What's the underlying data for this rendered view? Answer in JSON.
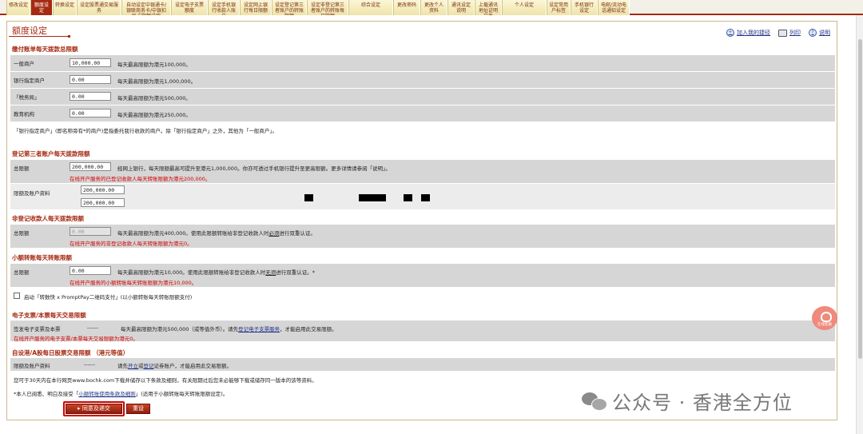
{
  "tabs": [
    {
      "label": "修改设定",
      "active": false
    },
    {
      "label": "额度设定",
      "active": true
    },
    {
      "label": "转换设定",
      "active": false
    },
    {
      "label": "设定股票通交易服务",
      "active": false
    },
    {
      "label": "自动设定中银通卡/银联商务卡/中银扣账卡限额设定",
      "active": false
    },
    {
      "label": "设定电子支票额度",
      "active": false
    },
    {
      "label": "设定手机银行收款人账户",
      "active": false
    },
    {
      "label": "设定网上银行每日限额",
      "active": false
    },
    {
      "label": "设定登记第三者账户的转账限额",
      "active": false
    },
    {
      "label": "设定非登记第三者账户的转账每日限额",
      "active": false
    },
    {
      "label": "综合设定",
      "active": false
    },
    {
      "label": "更改密码",
      "active": false
    },
    {
      "label": "更改个人资料",
      "active": false
    },
    {
      "label": "通讯设定说明",
      "active": false
    },
    {
      "label": "上载通讯地址证明文件",
      "active": false
    },
    {
      "label": "个人设定",
      "active": false
    },
    {
      "label": "设定常用户标签",
      "active": false
    },
    {
      "label": "手机银行设定",
      "active": false
    },
    {
      "label": "电邮/流动电话通知设定",
      "active": false
    }
  ],
  "page_title": "额度设定",
  "toplinks": {
    "bookmark": "加入我的捷径",
    "print": "列印",
    "help": "说明"
  },
  "s1": {
    "title": "缴付账单每天拨款总限额",
    "rows": [
      {
        "label": "一般商户",
        "value": "10,000.00",
        "desc": "每天最高限额为港元100,000。"
      },
      {
        "label": "银行指定商户",
        "value": "0.00",
        "desc": "每天最高限额为港元1,000,000。"
      },
      {
        "label": "「税务局」",
        "value": "0.00",
        "desc": "每天最高限额为港元500,000。"
      },
      {
        "label": "教育机构",
        "value": "0.00",
        "desc": "每天最高限额为港元250,000。"
      }
    ],
    "note": "「银行指定商户」(即名称旁有*的商户)是指委托我行收款的商户。除「银行指定商户」之外，其他为「一般商户」。"
  },
  "s2": {
    "title": "登记第三者账户每天拨款限额",
    "total_label": "总限额",
    "total_value": "200,000.00",
    "total_desc": "经网上银行，每天限额最高可提升至港元1,000,000。你亦可透过手机银行提升至更高限额。更多详情请参阅「说明」。",
    "total_red": "在线开户服务的已登记收款人每天转账限额为港元200,000。",
    "acct_label": "限额及账户资料",
    "acct_value1": "200,000.00",
    "acct_value2": "200,000.00"
  },
  "s3": {
    "title": "非登记收款人每天拨款限额",
    "label": "总限额",
    "value": "0.00",
    "desc_a": "每天最高限额为港元400,000。使用此限额转账给非登记收款人时",
    "desc_u": "必须",
    "desc_b": "进行双重认证。",
    "red": "在线开户服务的非登记收款人每天转账限额为港元0。"
  },
  "s4": {
    "title": "小额转账每天转账限额",
    "label": "总限额",
    "value": "0.00",
    "desc_a": "每天最高限额为港元10,000。使用此限额转账给非登记收款人时",
    "desc_u": "无须",
    "desc_b": "进行双重认证。*",
    "red": "在线开户服务的小额转账每天转账限额为港元10,000。",
    "checkbox_label": "启动「转数快 x PromptPay二维码支付」(以小额转账每天转账限额支付)"
  },
  "s5": {
    "title": "电子支票/本票每天交易限额",
    "label": "签发电子支票及本票",
    "dashes": "------",
    "desc_a": "每天最高限额为港元500,000（或等值外币）。请先",
    "desc_link": "登记电子支票服务",
    "desc_b": "，才能启用此交易限额。",
    "red": "在线开户服务的电子支票/本票每天交易限额为港元0。"
  },
  "s6": {
    "title": "自设港/A股每日股票交易限额 （港元等值）",
    "label": "限额及账户资料",
    "dashes": "------",
    "desc_a": "请先",
    "desc_link1": "开立",
    "desc_or": "或",
    "desc_link2": "登记",
    "desc_b": "证券账户，才能启用此交易限额。"
  },
  "footer": {
    "line1": "您可于30天内在本行网页www.bochk.com下载并储存以下条款及细则，有关限期过后您未必能够下载或储存同一版本的该等资料。",
    "line2_a": "*本人已阅悉、明白及接受「",
    "line2_link": "小额转账使用条款及细则",
    "line2_b": "」(适用于小额转账每天转账限额设定)。"
  },
  "buttons": {
    "submit": "同意及递交",
    "reset": "重设"
  },
  "float_button": "在线客服",
  "watermark": "公众号 · 香港全方位"
}
